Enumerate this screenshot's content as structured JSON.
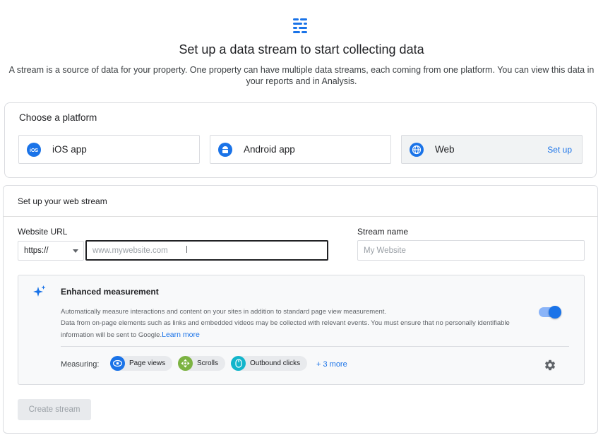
{
  "header": {
    "icon": "data-stream-icon",
    "title": "Set up a data stream to start collecting data",
    "subtitle": "A stream is a source of data for your property. One property can have multiple data streams, each coming from one platform. You can view this data in your reports and in Analysis."
  },
  "platform": {
    "heading": "Choose a platform",
    "options": [
      {
        "label": "iOS app",
        "icon": "ios-icon"
      },
      {
        "label": "Android app",
        "icon": "android-icon"
      },
      {
        "label": "Web",
        "icon": "globe-icon",
        "action": "Set up",
        "selected": true
      }
    ]
  },
  "stream": {
    "header": "Set up your web stream",
    "url_label": "Website URL",
    "protocol": "https://",
    "url_placeholder": "www.mywebsite.com",
    "name_label": "Stream name",
    "name_placeholder": "My Website"
  },
  "enhanced": {
    "icon": "sparkle-icon",
    "title": "Enhanced measurement",
    "desc_line1": "Automatically measure interactions and content on your sites in addition to standard page view measurement.",
    "desc_line2": "Data from on-page elements such as links and embedded videos may be collected with relevant events. You must ensure that no personally identifiable information will be sent to Google.",
    "learn_more": "Learn more",
    "enabled": true,
    "measuring_label": "Measuring:",
    "chips": [
      {
        "label": "Page views",
        "icon": "eye-icon"
      },
      {
        "label": "Scrolls",
        "icon": "scroll-icon"
      },
      {
        "label": "Outbound clicks",
        "icon": "click-icon"
      }
    ],
    "more": "+ 3 more"
  },
  "actions": {
    "create_label": "Create stream"
  },
  "colors": {
    "accent": "#1a73e8",
    "page_views": "#1a73e8",
    "scrolls": "#7cb342",
    "outbound": "#12b5cb"
  }
}
